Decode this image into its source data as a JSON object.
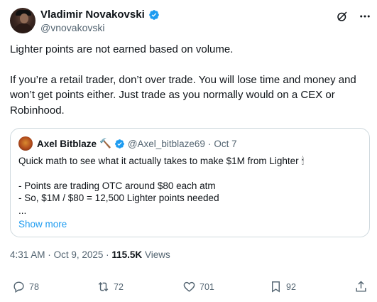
{
  "author": {
    "name": "Vladimir Novakovski",
    "handle": "@vnovakovski",
    "verified_color": "#1d9bf0"
  },
  "header_icons": [
    "grok-icon",
    "more-icon"
  ],
  "tweet": {
    "paragraph1": "Lighter points are not earned based on volume.",
    "paragraph2": "If you’re a retail trader, don’t over trade.  You will lose time and money and won’t get points either.  Just trade as you normally would on a CEX or Robinhood."
  },
  "quote": {
    "name": "Axel Bitblaze",
    "name_emoji": "🔨",
    "handle": "@Axel_bitblaze69",
    "separator": "·",
    "date": "Oct 7",
    "line1": "Quick math to see what it actually takes to make $1M from Lighter",
    "line1_emoji": "🕯",
    "line2": "- Points are trading OTC around $80 each atm",
    "line3": "- So, $1M / $80 = 12,500 Lighter points needed",
    "line4": "...",
    "show_more": "Show more"
  },
  "meta": {
    "time": "4:31 AM",
    "date": "Oct 9, 2025",
    "views_count": "115.5K",
    "views_label": "Views",
    "separator": "·"
  },
  "actions": {
    "replies": "78",
    "reposts": "72",
    "likes": "701",
    "bookmarks": "92"
  },
  "colors": {
    "accent": "#1d9bf0",
    "text": "#0f1419",
    "secondary": "#536471",
    "border": "#cfd9de"
  }
}
